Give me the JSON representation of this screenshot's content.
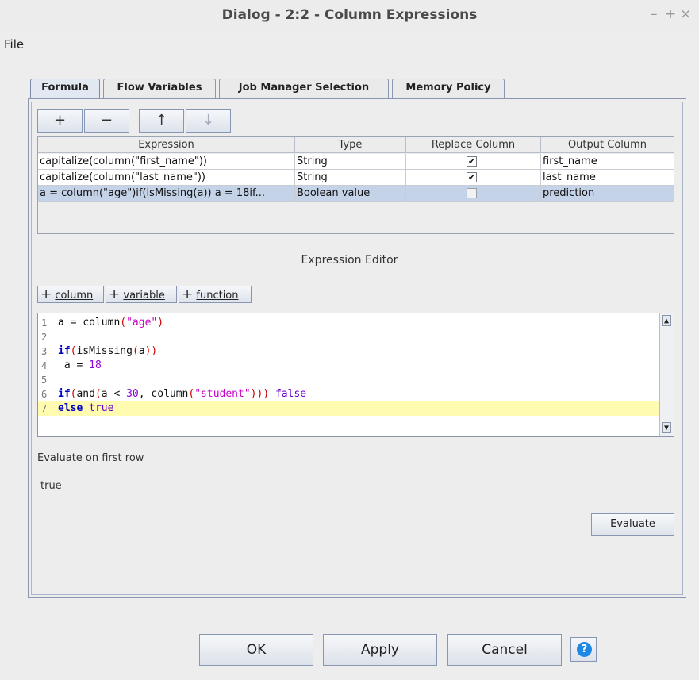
{
  "window": {
    "title": "Dialog - 2:2 - Column Expressions",
    "minimize": "–",
    "maximize": "+",
    "close": "×"
  },
  "menu": {
    "file": "File"
  },
  "tabs": [
    {
      "label": "Formula",
      "active": true
    },
    {
      "label": "Flow Variables"
    },
    {
      "label": "Job Manager Selection"
    },
    {
      "label": "Memory Policy"
    }
  ],
  "toolbar": {
    "add": "+",
    "remove": "−",
    "up": "↑",
    "down": "↓"
  },
  "table": {
    "headers": [
      "Expression",
      "Type",
      "Replace Column",
      "Output Column"
    ],
    "rows": [
      {
        "expression": "capitalize(column(\"first_name\"))",
        "type": "String",
        "replace": true,
        "output": "first_name"
      },
      {
        "expression": "capitalize(column(\"last_name\"))",
        "type": "String",
        "replace": true,
        "output": "last_name"
      },
      {
        "expression": "a = column(\"age\")if(isMissing(a)) a = 18if...",
        "type": "Boolean value",
        "replace": false,
        "output": "prediction",
        "selected": true
      }
    ]
  },
  "editor": {
    "label": "Expression Editor",
    "insert_buttons": [
      {
        "plus": "+",
        "label": "column"
      },
      {
        "plus": "+",
        "label": "variable"
      },
      {
        "plus": "+",
        "label": "function"
      }
    ],
    "line_numbers": [
      "1",
      "2",
      "3",
      "4",
      "5",
      "6",
      "7"
    ],
    "code": {
      "l1_a": "a = ",
      "l1_col": "column",
      "l1_str": "\"age\"",
      "l3_if": "if",
      "l3_mid": "isMissing",
      "l3_a": "a",
      "l4_a": " a = ",
      "l4_num": "18",
      "l6_if": "if",
      "l6_and": "and",
      "l6_a": "a < ",
      "l6_num": "30",
      "l6_col": ", column",
      "l6_str": "\"student\"",
      "l6_false": "false",
      "l7_else": "else",
      "l7_true": "true"
    },
    "scroll_up": "▲",
    "scroll_down": "▼"
  },
  "evaluate": {
    "label": "Evaluate on first row",
    "result": "true",
    "button": "Evaluate"
  },
  "buttons": {
    "ok": "OK",
    "apply": "Apply",
    "cancel": "Cancel",
    "help": "?"
  },
  "colors": {
    "selection": "#c4d3e8",
    "highlight_line": "#fffbb0",
    "help_icon": "#1e88e5"
  }
}
